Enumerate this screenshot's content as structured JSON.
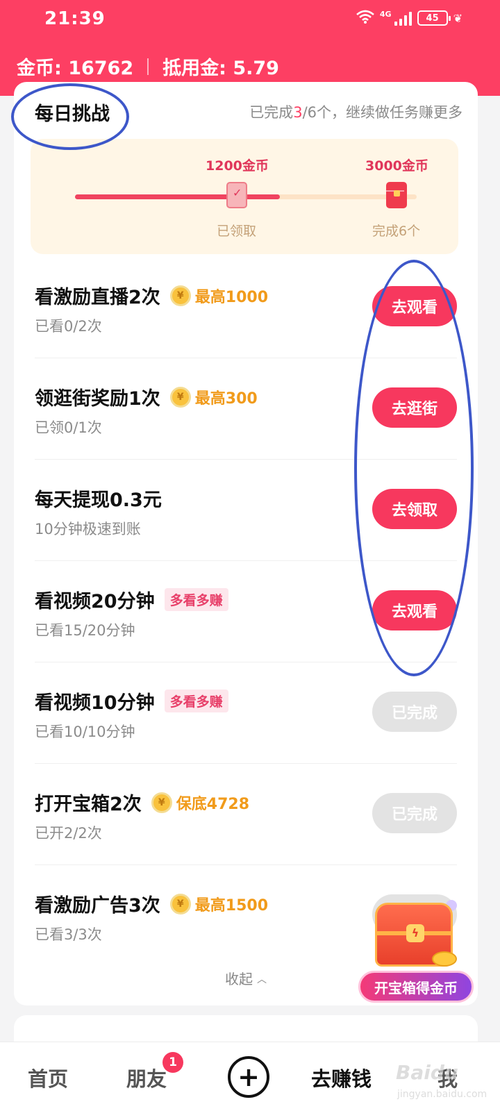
{
  "status_bar": {
    "time": "21:39",
    "network": "4G",
    "battery": "45"
  },
  "header": {
    "coins_label": "金币: 16762",
    "deduction_label": "抵用金: 5.79"
  },
  "challenge": {
    "title": "每日挑战",
    "hint_prefix": "已完成",
    "hint_done": "3",
    "hint_suffix": "/6个，继续做任务赚更多",
    "progress_fraction": 0.6,
    "milestones": [
      {
        "reward": "1200金币",
        "status": "已领取",
        "claimed": true
      },
      {
        "reward": "3000金币",
        "status": "完成6个",
        "claimed": false
      }
    ]
  },
  "tasks": [
    {
      "title": "看激励直播2次",
      "reward_icon": "coin-icon",
      "reward": "最高1000",
      "tag": "",
      "sub": "已看0/2次",
      "button": "去观看",
      "done": false
    },
    {
      "title": "领逛街奖励1次",
      "reward_icon": "coin-icon",
      "reward": "最高300",
      "tag": "",
      "sub": "已领0/1次",
      "button": "去逛街",
      "done": false
    },
    {
      "title": "每天提现0.3元",
      "reward_icon": "",
      "reward": "",
      "tag": "",
      "sub": "10分钟极速到账",
      "button": "去领取",
      "done": false
    },
    {
      "title": "看视频20分钟",
      "reward_icon": "",
      "reward": "",
      "tag": "多看多赚",
      "sub": "已看15/20分钟",
      "button": "去观看",
      "done": false
    },
    {
      "title": "看视频10分钟",
      "reward_icon": "",
      "reward": "",
      "tag": "多看多赚",
      "sub": "已看10/10分钟",
      "button": "已完成",
      "done": true
    },
    {
      "title": "打开宝箱2次",
      "reward_icon": "coin-icon",
      "reward": "保底4728",
      "tag": "",
      "sub": "已开2/2次",
      "button": "已完成",
      "done": true
    },
    {
      "title": "看激励广告3次",
      "reward_icon": "coin-icon",
      "reward": "最高1500",
      "tag": "",
      "sub": "已看3/3次",
      "button": "",
      "done": true
    }
  ],
  "collapse_label": "收起",
  "chest": {
    "label": "开宝箱得金币"
  },
  "bottom_nav": {
    "home": "首页",
    "friends": "朋友",
    "friends_badge": "1",
    "earn": "去赚钱",
    "me": "我"
  },
  "watermark": {
    "main": "Baidu",
    "sub": "jingyan.baidu.com"
  },
  "colors": {
    "brand": "#fd3f63",
    "button": "#f7385e",
    "reward": "#f19b1b",
    "annotation_ring": "#3d57c9"
  }
}
